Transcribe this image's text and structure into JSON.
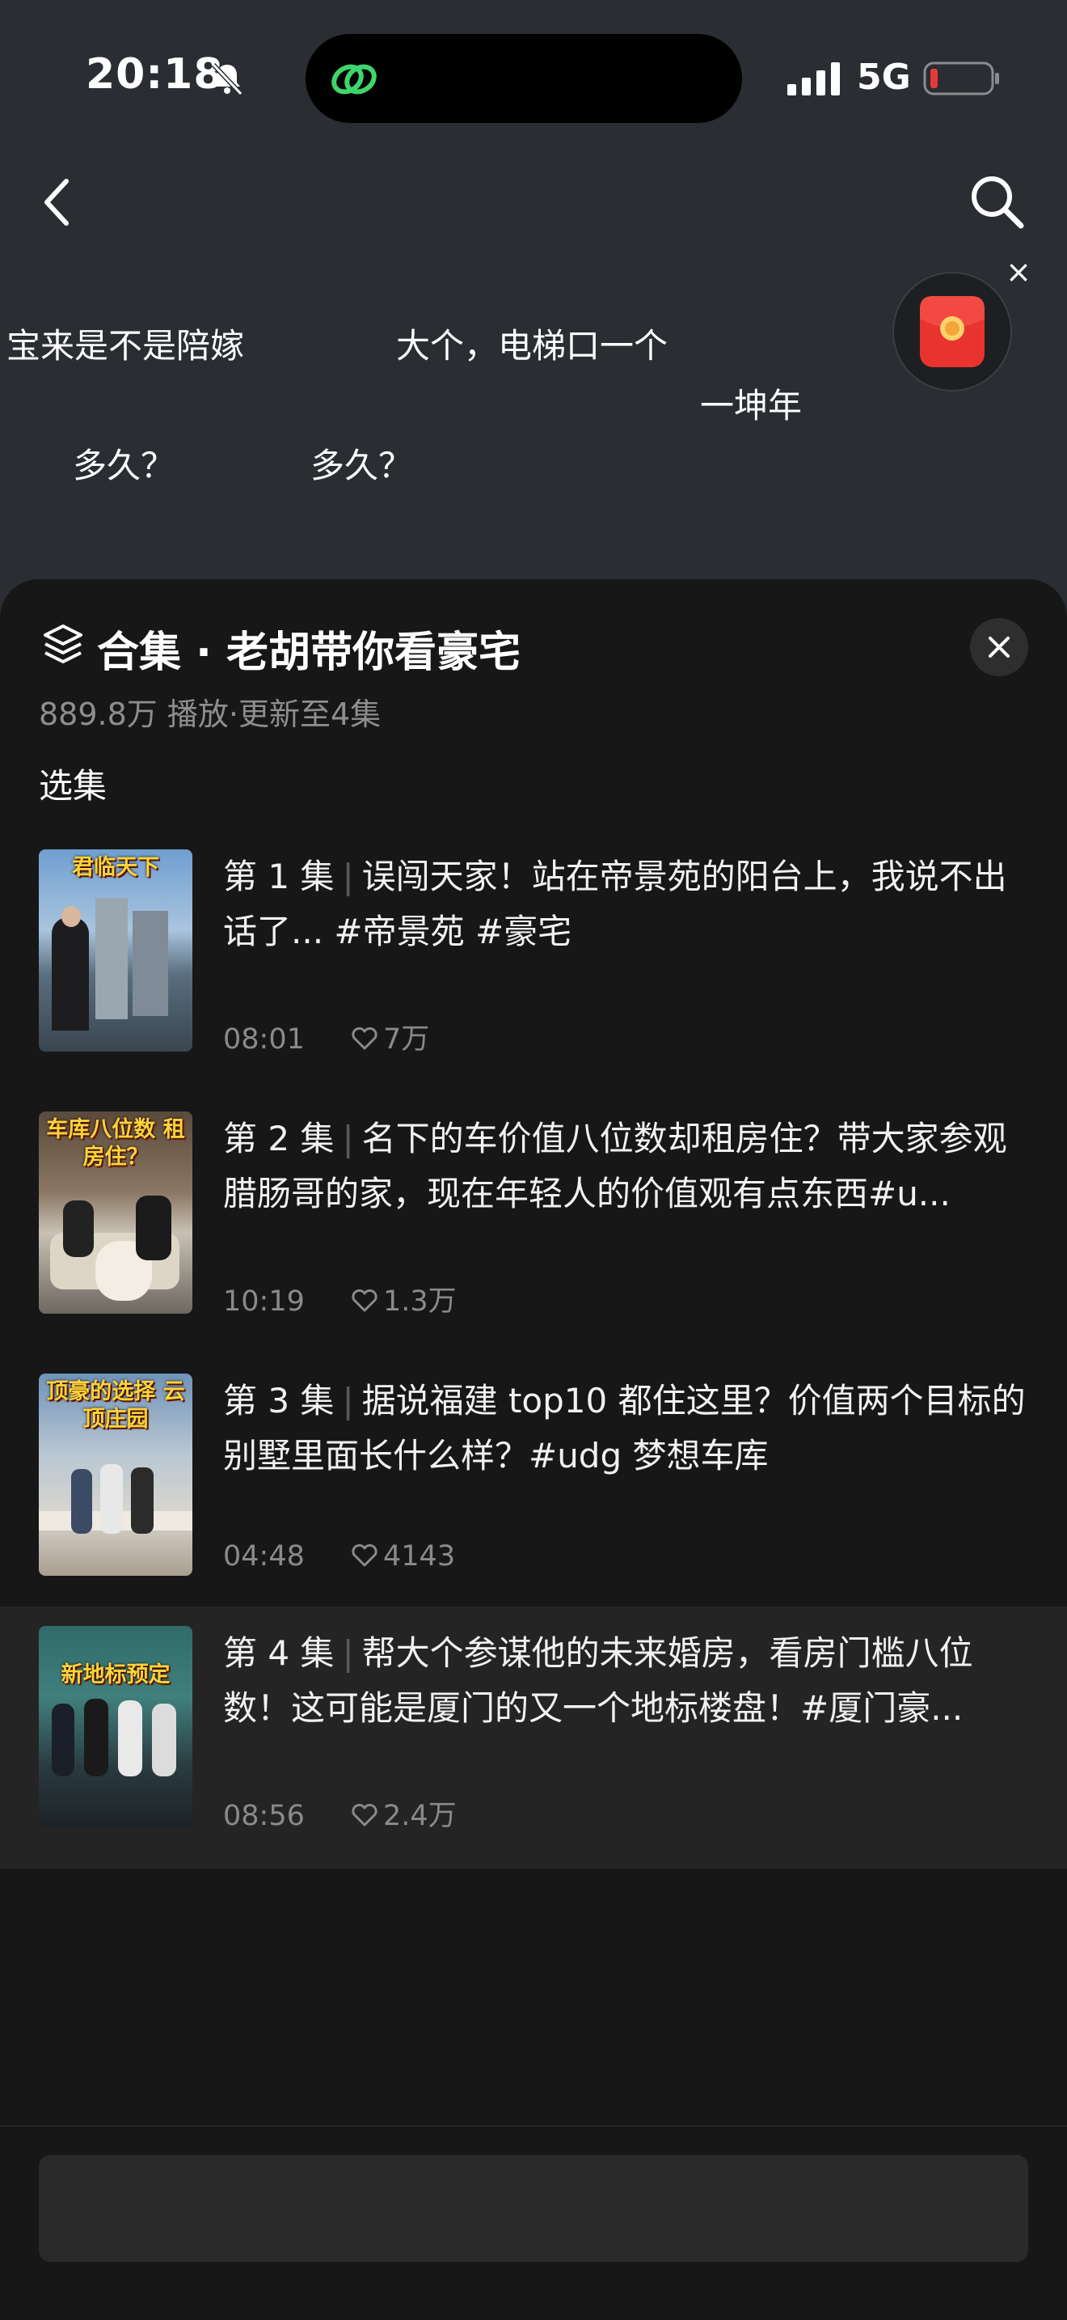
{
  "status": {
    "time": "20:18",
    "network": "5G",
    "icons": [
      "bell-muted-icon",
      "link-icon",
      "signal-icon",
      "battery-low-icon"
    ]
  },
  "nav": {
    "icons": [
      "back-icon",
      "search-icon"
    ]
  },
  "danmaku": [
    "宝来是不是陪嫁",
    "大个，电梯口一个",
    "一坤年",
    "多久？",
    "多久？"
  ],
  "red_packet": {
    "icon": "red-packet-icon",
    "close": "×"
  },
  "sheet": {
    "title": "合集 · 老胡带你看豪宅",
    "subtitle": "889.8万 播放·更新至4集",
    "section": "选集",
    "episodes": [
      {
        "num": "第 1 集",
        "title": "误闯天家！站在帝景苑的阳台上，我说不出话了... #帝景苑 #豪宅",
        "thumb_text": "君临天下",
        "duration": "08:01",
        "likes": "7万"
      },
      {
        "num": "第 2 集",
        "title": "名下的车价值八位数却租房住？带大家参观腊肠哥的家，现在年轻人的价值观有点东西#u...",
        "thumb_text": "车库八位数 租房住？",
        "duration": "10:19",
        "likes": "1.3万"
      },
      {
        "num": "第 3 集",
        "title": "据说福建 top10 都住这里？价值两个目标的别墅里面长什么样？#udg 梦想车库",
        "thumb_text": "顶豪的选择 云顶庄园",
        "duration": "04:48",
        "likes": "4143"
      },
      {
        "num": "第 4 集",
        "title": "帮大个参谋他的未来婚房，看房门槛八位数！这可能是厦门的又一个地标楼盘！#厦门豪...",
        "thumb_text": "新地标预定",
        "duration": "08:56",
        "likes": "2.4万",
        "active": true
      }
    ]
  },
  "colors": {
    "background": "#2a2d31",
    "sheet": "#171717",
    "active_row": "#242424",
    "muted_text": "#8e8e8e",
    "battery_low": "#e5393a",
    "red_packet": "#e8332f"
  }
}
